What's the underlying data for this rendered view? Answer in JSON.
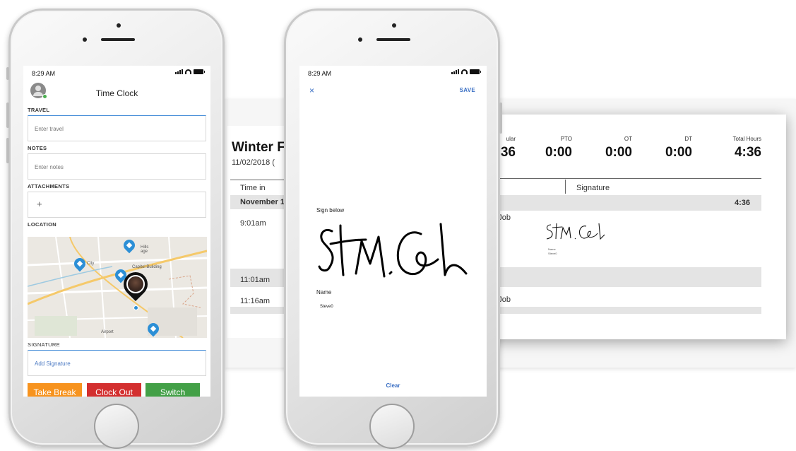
{
  "timesheet_back": {
    "title": "Winter F",
    "date": "11/02/2018 (",
    "col_time_in": "Time in",
    "row_day": "November 1",
    "times": [
      "9:01am",
      "11:01am",
      "11:16am"
    ]
  },
  "timesheet_front": {
    "summary": [
      {
        "label": "ular",
        "value": "36"
      },
      {
        "label": "PTO",
        "value": "0:00"
      },
      {
        "label": "OT",
        "value": "0:00"
      },
      {
        "label": "DT",
        "value": "0:00"
      },
      {
        "label": "Total Hours",
        "value": "4:36"
      }
    ],
    "col_signature": "Signature",
    "day_total": "4:36",
    "job_1": "ub Job",
    "job_2": "ub Job",
    "signature_caption_1": "Name",
    "signature_caption_2": "Steve0"
  },
  "left_phone": {
    "status_time": "8:29 AM",
    "title": "Time Clock",
    "travel_label": "TRAVEL",
    "travel_placeholder": "Enter travel",
    "notes_label": "NOTES",
    "notes_placeholder": "Enter notes",
    "attachments_label": "ATTACHMENTS",
    "attachments_add": "+",
    "location_label": "LOCATION",
    "map_labels": [
      "Hills",
      "age",
      "Capitol Building",
      "City",
      "Airport"
    ],
    "signature_label": "SIGNATURE",
    "add_signature": "Add Signature",
    "buttons": {
      "take_break": "Take Break",
      "clock_out": "Clock Out",
      "switch": "Switch"
    },
    "colors": {
      "take_break": "#f7931e",
      "clock_out": "#d32f2f",
      "switch": "#43a047",
      "pin": "#2c8fd6"
    }
  },
  "mid_phone": {
    "status_time": "8:29 AM",
    "close": "×",
    "save": "SAVE",
    "sign_below": "Sign below",
    "name_label": "Name",
    "name_value": "Steve0",
    "clear": "Clear",
    "accent": "#3a6fc4"
  }
}
